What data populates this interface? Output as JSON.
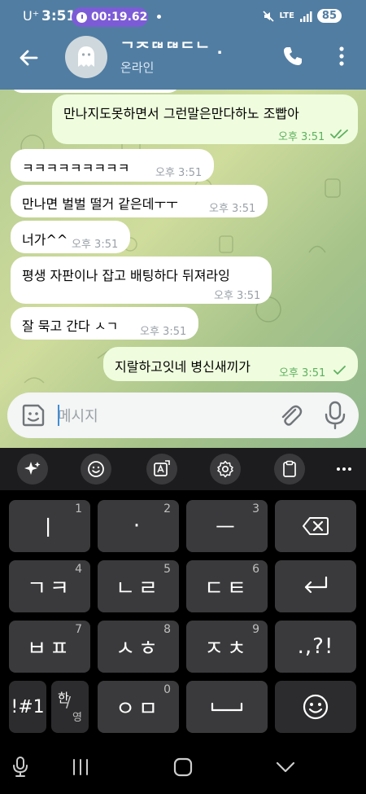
{
  "status_bar": {
    "carrier": "U⁺",
    "time": "3:51",
    "timer": "00:19.62",
    "network": "LTE",
    "battery": "85",
    "icons": [
      "stopwatch-icon",
      "mute-icon",
      "lte-icon",
      "signal-icon",
      "battery-icon"
    ]
  },
  "chat_header": {
    "title": "ᄀᄌᄃᄇᄃᄇᄃᄂ .",
    "status": "온라인",
    "icons": [
      "back-arrow-icon",
      "ghost-avatar-icon",
      "phone-icon",
      "more-vertical-icon"
    ]
  },
  "messages": [
    {
      "dir": "out",
      "text": "만나지도못하면서 그런말은만다하노   조빱아",
      "time": "오후 3:51",
      "read": true
    },
    {
      "dir": "in",
      "text": "ㅋㅋㅋㅋㅋㅋㅋㅋㅋ",
      "time": "오후 3:51"
    },
    {
      "dir": "in",
      "text": "만나면 벌벌 떨거 같은데ㅜㅜ",
      "time": "오후 3:51"
    },
    {
      "dir": "in",
      "text": "너가^^",
      "time": "오후 3:51"
    },
    {
      "dir": "in",
      "text": "평생 자판이나 잡고 배팅하다 뒤져라잉",
      "time": "오후 3:51"
    },
    {
      "dir": "in",
      "text": "잘 묵고 간다 ㅅㄱ",
      "time": "오후 3:51"
    },
    {
      "dir": "out",
      "text": "지랄하고잇네 병신새끼가",
      "time": "오후 3:51",
      "read": false
    }
  ],
  "input": {
    "placeholder": "메시지",
    "value": "",
    "icons": [
      "emoji-icon",
      "attach-icon",
      "mic-icon"
    ]
  },
  "keyboard_toolbar": {
    "icons": [
      "ai-sparkle-icon",
      "emoji-icon",
      "translate-icon",
      "settings-icon",
      "clipboard-icon",
      "more-horizontal-icon"
    ]
  },
  "keyboard": {
    "rows": [
      [
        {
          "main": "ㅣ",
          "sub": "1"
        },
        {
          "main": "·",
          "sub": "2"
        },
        {
          "main": "ㅡ",
          "sub": "3"
        },
        {
          "main": "",
          "sub": "",
          "icon": "backspace-icon"
        }
      ],
      [
        {
          "main": "ㄱㅋ",
          "sub": "4"
        },
        {
          "main": "ㄴㄹ",
          "sub": "5"
        },
        {
          "main": "ㄷㅌ",
          "sub": "6"
        },
        {
          "main": "",
          "sub": "",
          "icon": "enter-icon"
        }
      ],
      [
        {
          "main": "ㅂㅍ",
          "sub": "7"
        },
        {
          "main": "ㅅㅎ",
          "sub": "8"
        },
        {
          "main": "ㅈㅊ",
          "sub": "9"
        },
        {
          "main": ".,?!",
          "sub": ""
        }
      ],
      [
        {
          "main": "!#1",
          "sub": ""
        },
        {
          "main": "한/영",
          "sub": ""
        },
        {
          "main": "ㅇㅁ",
          "sub": "0"
        },
        {
          "main": "",
          "sub": "",
          "icon": "space-icon"
        },
        {
          "main": "",
          "sub": "",
          "icon": "emoji-icon"
        }
      ]
    ],
    "lang_top": "한",
    "lang_bottom": "영"
  },
  "nav_bar": {
    "icons": [
      "keyboard-mic-icon",
      "recents-icon",
      "home-icon",
      "hide-keyboard-icon"
    ]
  },
  "colors": {
    "header": "#517da2",
    "incoming_bubble": "#ffffff",
    "outgoing_bubble": "#effdde",
    "outgoing_time": "#5db05f",
    "key": "#3a3a3c",
    "timer_pill": "#7c5cd6"
  }
}
